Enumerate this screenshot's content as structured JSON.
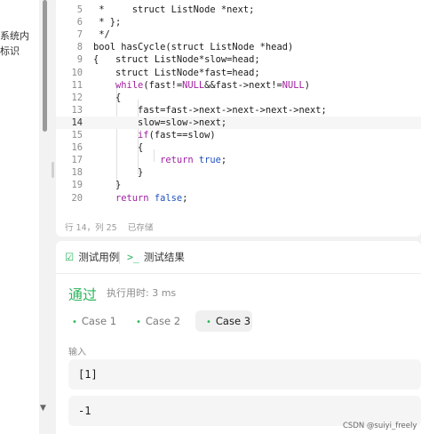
{
  "left_pane": {
    "lines": [
      "系统内",
      "标识"
    ]
  },
  "code": {
    "lines": [
      {
        "n": "5",
        "parts": [
          {
            "t": " *     struct ListNode *next;",
            "c": "#1a1a1a"
          }
        ]
      },
      {
        "n": "6",
        "parts": [
          {
            "t": " * };",
            "c": "#1a1a1a"
          }
        ]
      },
      {
        "n": "7",
        "parts": [
          {
            "t": " */",
            "c": "#1a1a1a"
          }
        ]
      },
      {
        "n": "8",
        "parts": [
          {
            "t": "bool ",
            "c": "#1a1a1a"
          },
          {
            "t": "hasCycle",
            "c": "#1a1a1a"
          },
          {
            "t": "(struct ListNode *head)",
            "c": "#1a1a1a"
          }
        ]
      },
      {
        "n": "9",
        "parts": [
          {
            "t": "{   struct ListNode*slow=head;",
            "c": "#1a1a1a"
          }
        ]
      },
      {
        "n": "10",
        "parts": [
          {
            "t": "    struct ListNode*fast=head;",
            "c": "#1a1a1a"
          }
        ]
      },
      {
        "n": "11",
        "parts": [
          {
            "t": "    ",
            "c": "#1a1a1a"
          },
          {
            "t": "while",
            "c": "#a020a0"
          },
          {
            "t": "(fast!=",
            "c": "#1a1a1a"
          },
          {
            "t": "NULL",
            "c": "#a020a0"
          },
          {
            "t": "&&fast->next!=",
            "c": "#1a1a1a"
          },
          {
            "t": "NULL",
            "c": "#a020a0"
          },
          {
            "t": ")",
            "c": "#1a1a1a"
          }
        ]
      },
      {
        "n": "12",
        "parts": [
          {
            "t": "    {",
            "c": "#1a1a1a"
          }
        ]
      },
      {
        "n": "13",
        "parts": [
          {
            "t": "        fast=fast->next->next->next->next;",
            "c": "#1a1a1a"
          }
        ]
      },
      {
        "n": "14",
        "parts": [
          {
            "t": "        slow=slow->next;",
            "c": "#1a1a1a"
          }
        ]
      },
      {
        "n": "15",
        "parts": [
          {
            "t": "        ",
            "c": "#1a1a1a"
          },
          {
            "t": "if",
            "c": "#a020a0"
          },
          {
            "t": "(fast==slow)",
            "c": "#1a1a1a"
          }
        ]
      },
      {
        "n": "16",
        "parts": [
          {
            "t": "        {",
            "c": "#1a1a1a"
          }
        ]
      },
      {
        "n": "17",
        "parts": [
          {
            "t": "            ",
            "c": "#1a1a1a"
          },
          {
            "t": "return",
            "c": "#a020a0"
          },
          {
            "t": " ",
            "c": "#1a1a1a"
          },
          {
            "t": "true",
            "c": "#2050c0"
          },
          {
            "t": ";",
            "c": "#1a1a1a"
          }
        ]
      },
      {
        "n": "18",
        "parts": [
          {
            "t": "        }",
            "c": "#1a1a1a"
          }
        ]
      },
      {
        "n": "19",
        "parts": [
          {
            "t": "    }",
            "c": "#1a1a1a"
          }
        ]
      },
      {
        "n": "20",
        "parts": [
          {
            "t": "    ",
            "c": "#1a1a1a"
          },
          {
            "t": "return",
            "c": "#a020a0"
          },
          {
            "t": " ",
            "c": "#1a1a1a"
          },
          {
            "t": "false",
            "c": "#2050c0"
          },
          {
            "t": ";",
            "c": "#1a1a1a"
          }
        ]
      }
    ],
    "active_line": "14"
  },
  "status_bar": {
    "position": "行 14，列 25",
    "saved": "已存储"
  },
  "panel": {
    "tab_testcase": "测试用例",
    "tab_result": "测试结果",
    "result_status": "通过",
    "runtime": "执行用时: 3 ms",
    "cases": [
      "Case 1",
      "Case 2",
      "Case 3"
    ],
    "active_case": "Case 3",
    "input_label": "输入",
    "values": [
      "[1]",
      "-1"
    ]
  },
  "watermark": "CSDN @suiyi_freely",
  "colors": {
    "accent_green": "#2db55d",
    "keyword": "#a020a0",
    "literal": "#2050c0"
  }
}
